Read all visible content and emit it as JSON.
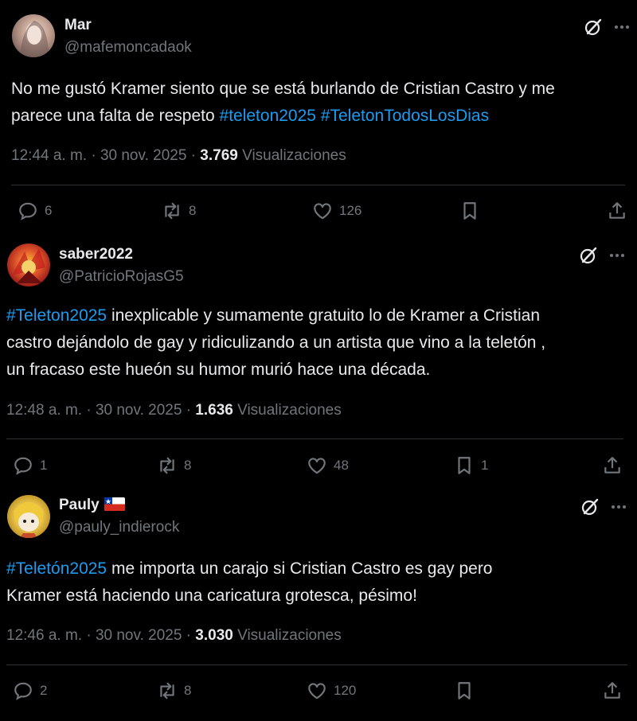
{
  "tweets": [
    {
      "name": "Mar",
      "handle": "@mafemoncadaok",
      "lines": [
        [
          {
            "t": "No me gustó Kramer siento que se está burlando de Cristian Castro y me"
          }
        ],
        [
          {
            "t": "parece una falta de respeto "
          },
          {
            "t": "#teleton2025",
            "tag": true
          },
          {
            "t": " "
          },
          {
            "t": "#TeletonTodosLosDias",
            "tag": true
          }
        ]
      ],
      "time": "12:44 a. m. · 30 nov. 2025 · ",
      "views": "3.769",
      "views_label": " Visualizaciones",
      "replies": "6",
      "reposts": "8",
      "likes": "126",
      "bookmarks": ""
    },
    {
      "name": "saber2022",
      "handle": "@PatricioRojasG5",
      "lines": [
        [
          {
            "t": "#Teleton2025",
            "tag": true
          },
          {
            "t": " inexplicable y sumamente gratuito lo de Kramer a Cristian"
          }
        ],
        [
          {
            "t": "castro dejándolo de gay y ridiculizando a un artista que vino a la teletón ,"
          }
        ],
        [
          {
            "t": "un fracaso este hueón su humor murió hace una década."
          }
        ]
      ],
      "time": "12:48 a. m. · 30 nov. 2025 · ",
      "views": "1.636",
      "views_label": " Visualizaciones",
      "replies": "1",
      "reposts": "8",
      "likes": "48",
      "bookmarks": "1"
    },
    {
      "name": "Pauly",
      "handle": "@pauly_indierock",
      "lines": [
        [
          {
            "t": "#Teletón2025",
            "tag": true
          },
          {
            "t": " me importa un carajo si Cristian Castro es gay pero"
          }
        ],
        [
          {
            "t": "Kramer está haciendo una caricatura grotesca,  pésimo!"
          }
        ]
      ],
      "time": "12:46 a. m. · 30 nov. 2025 · ",
      "views": "3.030",
      "views_label": " Visualizaciones",
      "replies": "2",
      "reposts": "8",
      "likes": "120",
      "bookmarks": ""
    }
  ],
  "colors": {
    "background": "#000000",
    "text": "#e7e9ea",
    "secondary": "#71767b",
    "hashtag": "#1d9bf0",
    "divider": "#2f3336"
  }
}
